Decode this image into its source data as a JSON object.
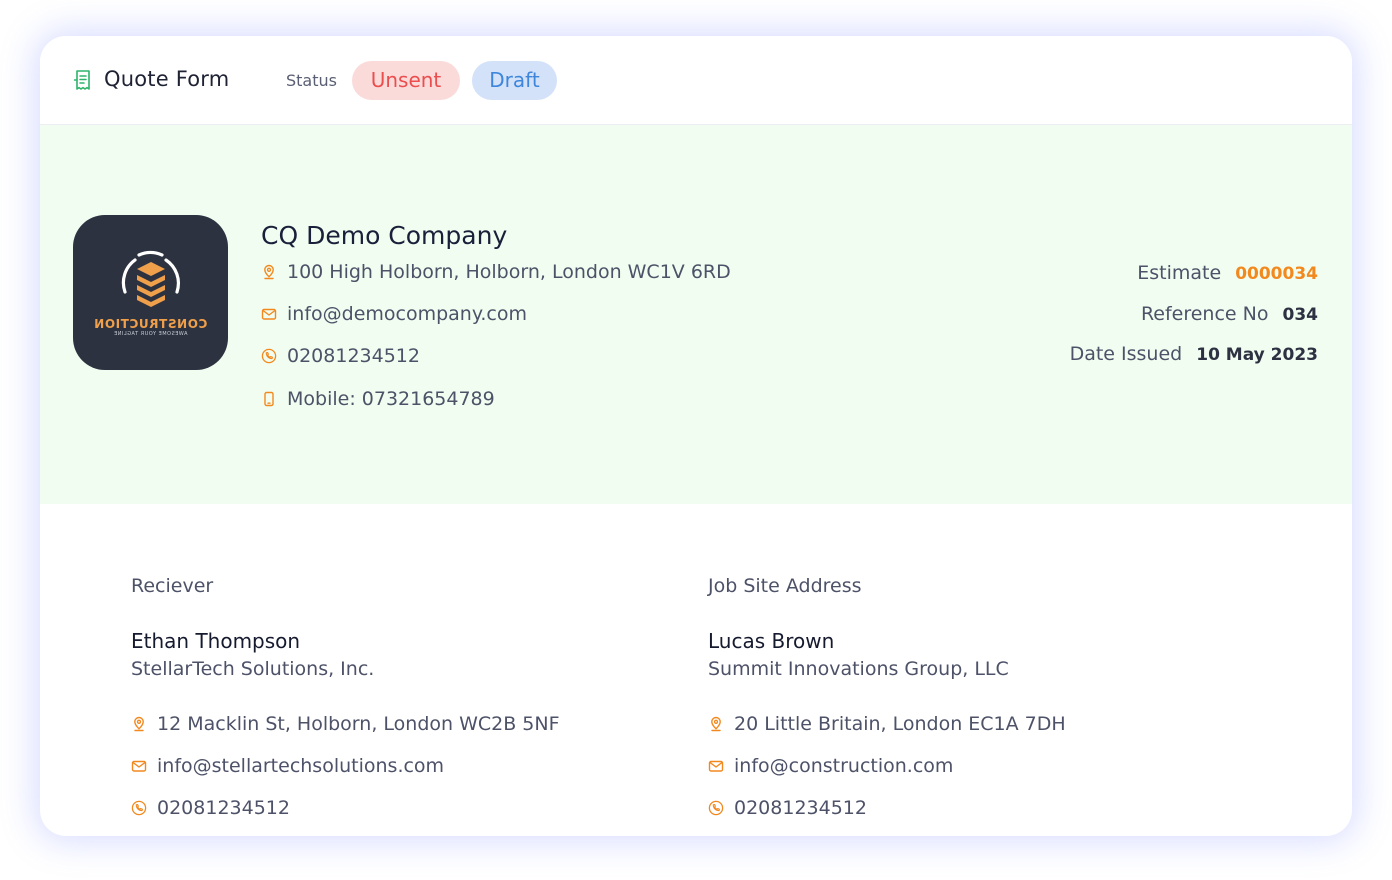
{
  "header": {
    "title": "Quote Form",
    "icon": "receipt-icon",
    "status_label": "Status",
    "badges": [
      {
        "label": "Unsent",
        "color": "#ea4e4e",
        "background": "#fbdada"
      },
      {
        "label": "Draft",
        "color": "#3e86dc",
        "background": "#d3e2f8"
      }
    ]
  },
  "company": {
    "name": "CQ Demo Company",
    "logo": {
      "text": "CONSTRUCTION",
      "tagline": "AWESOME YOUR TAGLINE"
    },
    "address": "100 High Holborn, Holborn, London WC1V 6RD",
    "email": "info@democompany.com",
    "phone": "02081234512",
    "mobile": "Mobile: 07321654789"
  },
  "quote_meta": {
    "estimate_label": "Estimate",
    "estimate_value": "0000034",
    "reference_label": "Reference No",
    "reference_value": "034",
    "date_label": "Date Issued",
    "date_value": "10 May 2023"
  },
  "receiver": {
    "heading": "Reciever",
    "name": "Ethan Thompson",
    "company": "StellarTech Solutions, Inc.",
    "address": "12 Macklin St, Holborn, London WC2B 5NF",
    "email": "info@stellartechsolutions.com",
    "phone": "02081234512"
  },
  "job_site": {
    "heading": "Job Site Address",
    "name": "Lucas Brown",
    "company": "Summit Innovations Group, LLC",
    "address": "20 Little Britain, London EC1A 7DH",
    "email": "info@construction.com",
    "phone": "02081234512"
  },
  "colors": {
    "accent_orange": "#f2891e",
    "band_green": "#f1fdf0",
    "logo_bg": "#2c3240",
    "icon_green": "#2db36a"
  }
}
